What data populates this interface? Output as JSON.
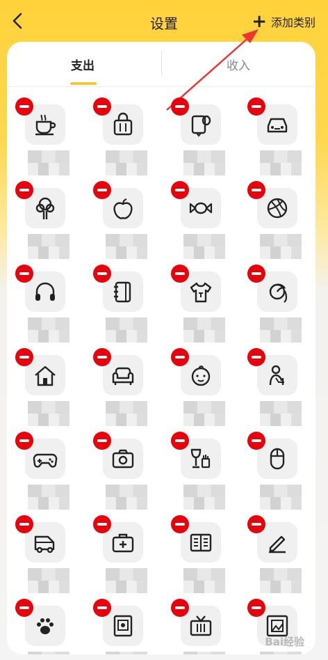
{
  "header": {
    "title": "设置",
    "add_label": "添加类别"
  },
  "tabs": [
    {
      "label": "支出",
      "active": true
    },
    {
      "label": "收入",
      "active": false
    }
  ],
  "accent_color": "#f6c73a",
  "delete_color": "#e8000b",
  "categories": [
    {
      "icon": "coffee-icon"
    },
    {
      "icon": "shopping-bag-icon"
    },
    {
      "icon": "toilet-paper-icon"
    },
    {
      "icon": "car-icon"
    },
    {
      "icon": "tree-icon"
    },
    {
      "icon": "apple-icon"
    },
    {
      "icon": "candy-icon"
    },
    {
      "icon": "basketball-icon"
    },
    {
      "icon": "headphones-icon"
    },
    {
      "icon": "notebook-icon"
    },
    {
      "icon": "tshirt-icon"
    },
    {
      "icon": "woman-face-icon"
    },
    {
      "icon": "house-icon"
    },
    {
      "icon": "sofa-icon"
    },
    {
      "icon": "baby-face-icon"
    },
    {
      "icon": "elderly-person-icon"
    },
    {
      "icon": "gamepad-icon"
    },
    {
      "icon": "camera-icon"
    },
    {
      "icon": "wine-glass-icon"
    },
    {
      "icon": "mouse-icon"
    },
    {
      "icon": "van-icon"
    },
    {
      "icon": "medical-kit-icon"
    },
    {
      "icon": "open-book-icon"
    },
    {
      "icon": "pencil-icon"
    },
    {
      "icon": "paw-icon"
    },
    {
      "icon": "photo-frame-icon"
    },
    {
      "icon": "tv-icon"
    },
    {
      "icon": "picture-icon"
    }
  ],
  "watermark": "Bai经验"
}
